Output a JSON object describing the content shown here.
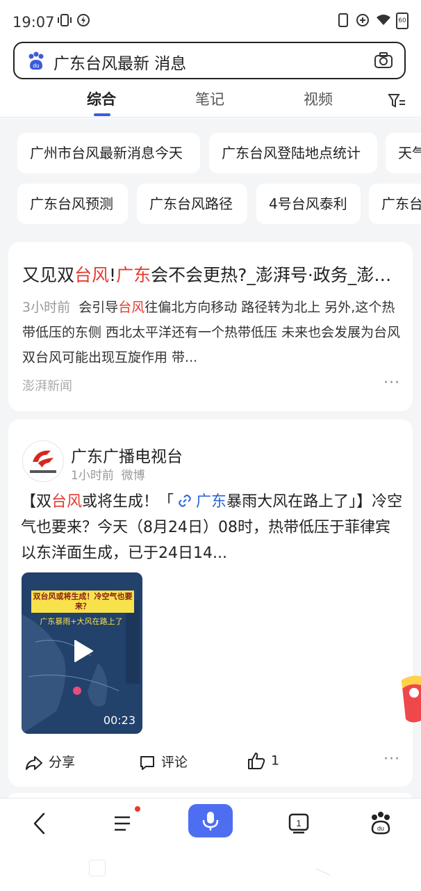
{
  "status_bar": {
    "time": "19:07",
    "battery": "60",
    "icons": [
      "vibrate-icon",
      "charging-icon",
      "phone-icon",
      "add-circle-icon",
      "wifi-icon",
      "battery-icon"
    ]
  },
  "search": {
    "query": "广东台风最新 消息"
  },
  "tabs": [
    {
      "label": "综合",
      "active": true
    },
    {
      "label": "笔记",
      "active": false
    },
    {
      "label": "视频",
      "active": false
    }
  ],
  "suggestions_row1": [
    "广州市台风最新消息今天",
    "广东台风登陆地点统计",
    "天气"
  ],
  "suggestions_row2": [
    "广东台风预测",
    "广东台风路径",
    "4号台风泰利",
    "广东台"
  ],
  "result1": {
    "title_parts": [
      "又见双",
      "台风",
      "!",
      "广东",
      "会不会更热?_澎湃号·政务_澎湃新闻"
    ],
    "time": "3小时前",
    "body_parts": [
      "会引导",
      "台风",
      "往偏北方向移动 路径转为北上 另外,这个热带低压的东侧 西北太平洋还有一个热带低压 未来也会发展为台风 双台风可能出现互旋作用 带..."
    ],
    "source": "澎湃新闻"
  },
  "result2": {
    "account": "广东广播电视台",
    "time": "1小时前",
    "platform": "微博",
    "text_parts": [
      "【双",
      "台风",
      "或将生成！「",
      "广东",
      "暴雨大风在路上了」】冷空气也要来？今天（8月24日）08时，热带低压于菲律宾以东洋面生成，已于24日14..."
    ],
    "video": {
      "banner": "双台风或将生成！冷空气也要来？",
      "sub": "广东暴雨+大风在路上了",
      "duration": "00:23"
    },
    "actions": {
      "share": "分享",
      "comment": "评论",
      "like_count": "1"
    }
  },
  "colors": {
    "highlight_red": "#e53a2f",
    "link_blue": "#2a66d6",
    "mic_blue": "#4e6ef2"
  }
}
